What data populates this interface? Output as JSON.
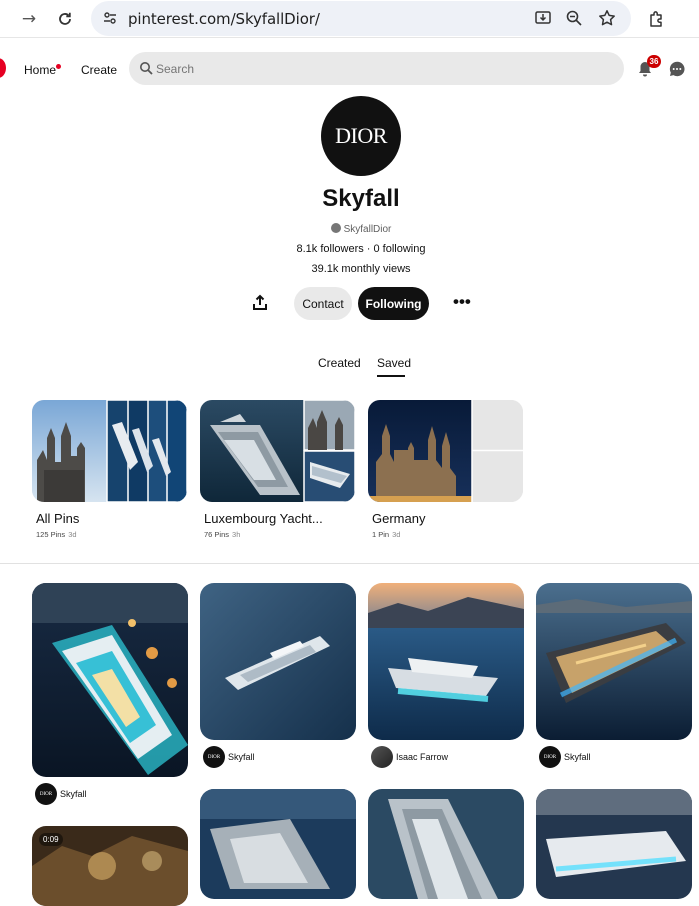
{
  "browser": {
    "url": "pinterest.com/SkyfallDior/",
    "icons": [
      "forward-icon",
      "reload-icon",
      "site-info-icon",
      "install-icon",
      "zoom-icon",
      "star-icon",
      "extensions-icon"
    ]
  },
  "appbar": {
    "nav": {
      "home": "Home",
      "create": "Create"
    },
    "search_placeholder": "Search",
    "notification_count": "36"
  },
  "profile": {
    "avatar_text": "DIOR",
    "name": "Skyfall",
    "handle": "SkyfallDior",
    "stats": "8.1k followers · 0 following",
    "monthly_views": "39.1k monthly views",
    "buttons": {
      "contact": "Contact",
      "following": "Following"
    }
  },
  "tabs": {
    "created": "Created",
    "saved": "Saved"
  },
  "boards": [
    {
      "title": "All Pins",
      "pins": "125 Pins",
      "age": "3d"
    },
    {
      "title": "Luxembourg Yacht...",
      "pins": "76 Pins",
      "age": "3h"
    },
    {
      "title": "Germany",
      "pins": "1 Pin",
      "age": "3d"
    }
  ],
  "pins": [
    {
      "user": "Skyfall"
    },
    {
      "user": "Skyfall"
    },
    {
      "user": "Isaac Farrow"
    },
    {
      "user": "Skyfall"
    },
    {
      "duration": "0:09"
    }
  ],
  "colors": {
    "accent": "#e60023",
    "following_button": "#111111"
  }
}
